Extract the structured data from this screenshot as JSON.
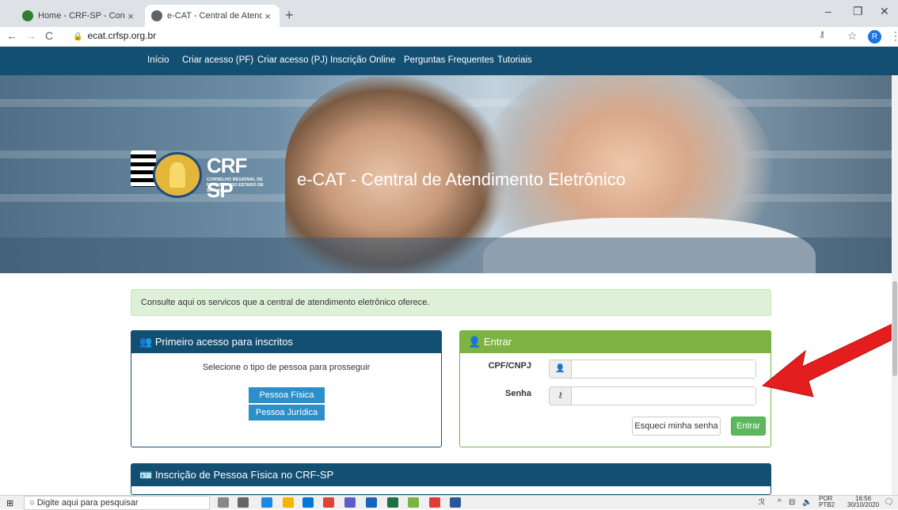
{
  "browser": {
    "tabs": [
      {
        "title": "Home - CRF-SP - Conselho Regic",
        "close": "×",
        "favicon_color": "#2e7d32"
      },
      {
        "title": "e-CAT - Central de Atendimento",
        "close": "×",
        "favicon_color": "#5f6368"
      }
    ],
    "new_tab": "+",
    "url": "ecat.crfsp.org.br",
    "profile_initial": "R"
  },
  "nav": {
    "items": [
      "Início",
      "Criar acesso (PF)",
      "Criar acesso (PJ)",
      "Inscrição Online",
      "Perguntas Frequentes",
      "Tutoriais"
    ]
  },
  "hero": {
    "logo_text": "CRF SP",
    "logo_sub": "CONSELHO REGIONAL DE FARMÁCIA DO ESTADO DE SÃO PAULO",
    "title": "e-CAT - Central de Atendimento Eletrônico"
  },
  "alert": {
    "text": "Consulte aqui os servicos que a central de atendimento eletrônico oferece."
  },
  "first_access": {
    "title": "Primeiro acesso para inscritos",
    "hint": "Selecione o tipo de pessoa para prosseguir",
    "btn_pf": "Pessoa Física",
    "btn_pj": "Pessoa Jurídica"
  },
  "login": {
    "title": "Entrar",
    "cpf_label": "CPF/CNPJ",
    "cpf_value": "",
    "password_label": "Senha",
    "password_value": "",
    "forgot": "Esqueci minha senha",
    "submit": "Entrar"
  },
  "registration": {
    "title": "Inscrição de Pessoa Física no CRF-SP"
  },
  "taskbar": {
    "search_placeholder": "Digite aqui para pesquisar",
    "lang": "POR",
    "lang2": "PTB2",
    "time": "16:56",
    "date": "30/10/2020"
  },
  "colors": {
    "nav": "#134f72",
    "green": "#7cb342",
    "arrow": "#e41e1e"
  }
}
